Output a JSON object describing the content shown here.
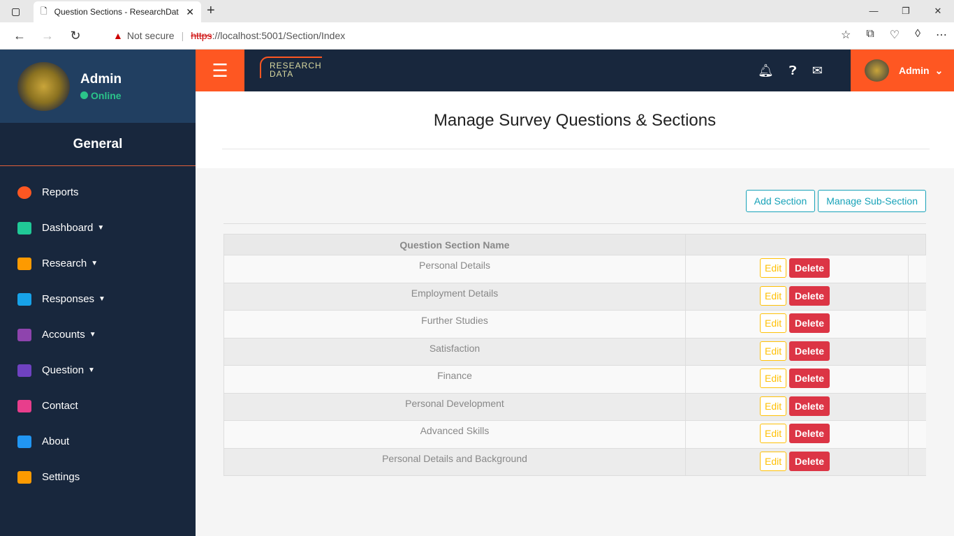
{
  "browser": {
    "tab_title": "Question Sections - ResearchDat",
    "not_secure": "Not secure",
    "url_scheme": "https",
    "url_rest": "://localhost:5001/Section/Index"
  },
  "sidebar": {
    "user": "Admin",
    "status": "Online",
    "section": "General",
    "items": [
      {
        "label": "Reports",
        "icon": "clock-icon",
        "color": "#fe5722",
        "caret": false
      },
      {
        "label": "Dashboard",
        "icon": "chart-icon",
        "color": "#20c997",
        "caret": true
      },
      {
        "label": "Research",
        "icon": "copy-icon",
        "color": "#fd9a00",
        "caret": true
      },
      {
        "label": "Responses",
        "icon": "screen-icon",
        "color": "#17a2e8",
        "caret": true
      },
      {
        "label": "Accounts",
        "icon": "map-icon",
        "color": "#8e44ad",
        "caret": true
      },
      {
        "label": "Question",
        "icon": "table-icon",
        "color": "#6f42c1",
        "caret": true
      },
      {
        "label": "Contact",
        "icon": "send-icon",
        "color": "#e83e8c",
        "caret": false
      },
      {
        "label": "About",
        "icon": "briefcase-icon",
        "color": "#2196f3",
        "caret": false
      },
      {
        "label": "Settings",
        "icon": "gear-icon",
        "color": "#fd9a00",
        "caret": false
      }
    ]
  },
  "topbar": {
    "logo_line1": "RESEARCH",
    "logo_line2": "DATA",
    "user": "Admin"
  },
  "main": {
    "title": "Manage Survey Questions & Sections",
    "add_section": "Add Section",
    "manage_sub": "Manage Sub-Section",
    "column": "Question Section Name",
    "edit": "Edit",
    "delete": "Delete",
    "rows": [
      "Personal Details",
      "Employment Details",
      "Further Studies",
      "Satisfaction",
      "Finance",
      "Personal Development",
      "Advanced Skills",
      "Personal Details and Background"
    ]
  }
}
